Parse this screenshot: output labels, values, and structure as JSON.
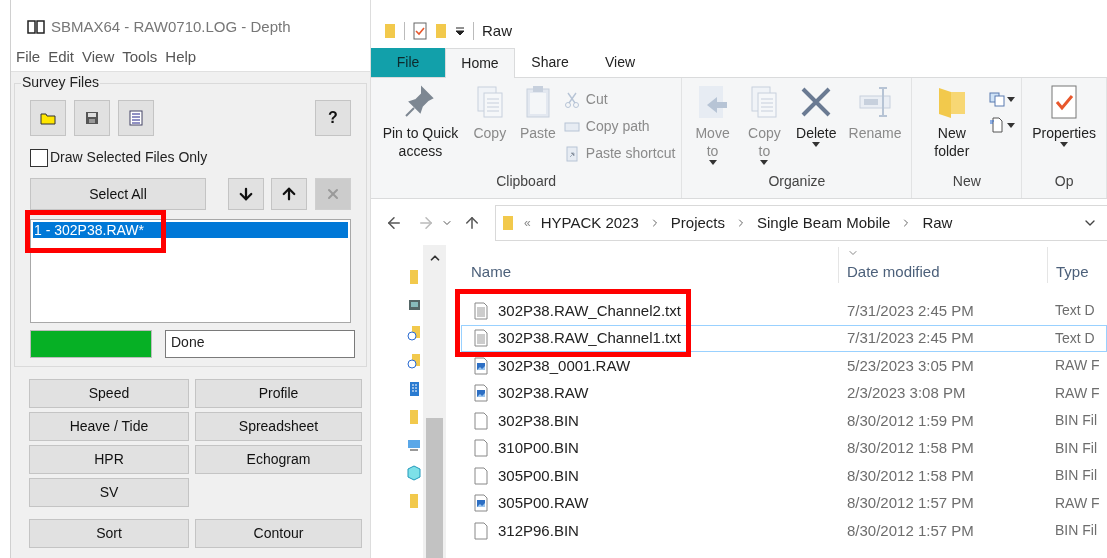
{
  "sbmax": {
    "title": "SBMAX64 - RAW0710.LOG - Depth",
    "menu": [
      "File",
      "Edit",
      "View",
      "Tools",
      "Help"
    ],
    "group_title": "Survey Files",
    "toolbar": [
      {
        "kind": "open"
      },
      {
        "kind": "save"
      },
      {
        "kind": "list"
      }
    ],
    "help_button": "?",
    "draw_selected_only": {
      "label": "Draw Selected Files Only",
      "checked": false
    },
    "select_all": "Select All",
    "move_buttons": [
      {
        "kind": "down"
      },
      {
        "kind": "up"
      }
    ],
    "remove_button": {
      "disabled": true
    },
    "files": [
      {
        "label": "1 - 302P38.RAW*",
        "selected": true
      }
    ],
    "progress": {
      "level": 1
    },
    "status": "Done",
    "action_rows": [
      [
        "Speed",
        "Profile"
      ],
      [
        "Heave / Tide",
        "Spreadsheet"
      ],
      [
        "HPR",
        "Echogram"
      ],
      [
        "SV"
      ]
    ],
    "bottom_row": [
      "Sort",
      "Contour"
    ]
  },
  "explorer": {
    "title": "Raw",
    "tabs": [
      {
        "label": "File",
        "kind": "file",
        "selected": false
      },
      {
        "label": "Home",
        "kind": "tab",
        "selected": true
      },
      {
        "label": "Share",
        "kind": "tab",
        "selected": false
      },
      {
        "label": "View",
        "kind": "tab",
        "selected": false
      }
    ],
    "ribbon": [
      {
        "label": "Clipboard",
        "items": [
          {
            "label": "Pin to Quick access",
            "kind": "pin",
            "disabled": false,
            "dropdown": false
          },
          {
            "label": "Copy",
            "kind": "copy",
            "disabled": true,
            "dropdown": false
          },
          {
            "label": "Paste",
            "kind": "paste",
            "disabled": true,
            "dropdown": false
          },
          {
            "label": "Cut",
            "kind": "cut",
            "disabled": true,
            "dropdown": false
          },
          {
            "label": "Copy path",
            "kind": "path",
            "disabled": true,
            "dropdown": false
          },
          {
            "label": "Paste shortcut",
            "kind": "shortcut",
            "disabled": true,
            "dropdown": false
          }
        ]
      },
      {
        "label": "Organize",
        "items": [
          {
            "label": "Move to",
            "kind": "move",
            "disabled": true,
            "dropdown": true
          },
          {
            "label": "Copy to",
            "kind": "copy",
            "disabled": true,
            "dropdown": true
          },
          {
            "label": "Delete",
            "kind": "delete",
            "disabled": false,
            "dropdown": true
          },
          {
            "label": "Rename",
            "kind": "rename",
            "disabled": true,
            "dropdown": false
          }
        ]
      },
      {
        "label": "New",
        "items": [
          {
            "label": "New folder",
            "kind": "folder",
            "disabled": false,
            "dropdown": false
          },
          {
            "kind": "item",
            "dropdown": true
          },
          {
            "kind": "access",
            "dropdown": true
          }
        ]
      },
      {
        "label": "Op",
        "items": [
          {
            "label": "Properties",
            "kind": "properties",
            "disabled": false,
            "dropdown": true
          }
        ]
      }
    ],
    "breadcrumb_overflow": "«",
    "breadcrumb": [
      "HYPACK 2023",
      "Projects",
      "Single Beam Mobile",
      "Raw"
    ],
    "nav_pane": [
      {
        "kind": "folder"
      },
      {
        "kind": "image"
      },
      {
        "kind": "link"
      },
      {
        "kind": "link"
      },
      {
        "kind": "building"
      },
      {
        "kind": "folder"
      },
      {
        "kind": "computer"
      },
      {
        "kind": "cube"
      },
      {
        "kind": "folder"
      }
    ],
    "columns": [
      "Name",
      "Date modified",
      "Type"
    ],
    "rows": [
      {
        "name": "302P38.RAW_Channel2.txt",
        "date": "7/31/2023 2:45 PM",
        "type": "Text D",
        "kind": "text",
        "focused": false
      },
      {
        "name": "302P38.RAW_Channel1.txt",
        "date": "7/31/2023 2:45 PM",
        "type": "Text D",
        "kind": "text",
        "focused": true
      },
      {
        "name": "302P38_0001.RAW",
        "date": "5/23/2023 3:05 PM",
        "type": "RAW F",
        "kind": "raw",
        "focused": false
      },
      {
        "name": "302P38.RAW",
        "date": "2/3/2023 3:08 PM",
        "type": "RAW F",
        "kind": "raw",
        "focused": false
      },
      {
        "name": "302P38.BIN",
        "date": "8/30/2012 1:59 PM",
        "type": "BIN Fil",
        "kind": "blank",
        "focused": false
      },
      {
        "name": "310P00.BIN",
        "date": "8/30/2012 1:58 PM",
        "type": "BIN Fil",
        "kind": "blank",
        "focused": false
      },
      {
        "name": "305P00.BIN",
        "date": "8/30/2012 1:58 PM",
        "type": "BIN Fil",
        "kind": "blank",
        "focused": false
      },
      {
        "name": "305P00.RAW",
        "date": "8/30/2012 1:57 PM",
        "type": "RAW F",
        "kind": "raw",
        "focused": false
      },
      {
        "name": "312P96.BIN",
        "date": "8/30/2012 1:57 PM",
        "type": "BIN Fil",
        "kind": "blank",
        "focused": false
      }
    ]
  }
}
